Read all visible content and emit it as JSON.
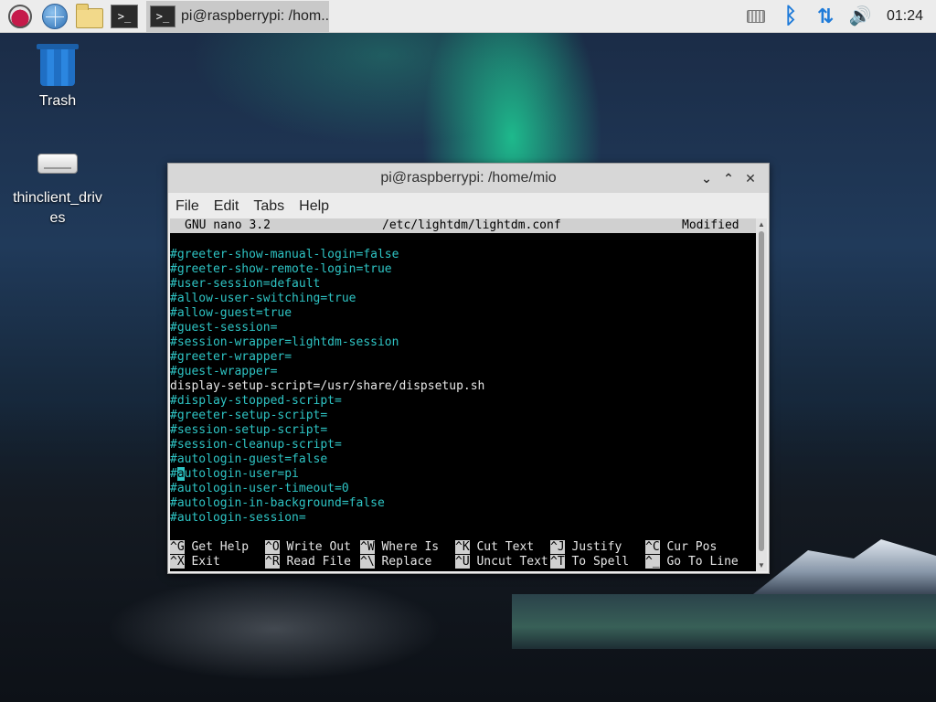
{
  "taskbar": {
    "task_title": "pi@raspberrypi: /hom...",
    "term_glyph": ">_",
    "clock": "01:24",
    "icons": [
      "raspberry-pi-menu-icon",
      "web-browser-icon",
      "file-manager-icon",
      "terminal-icon",
      "keyboard-icon",
      "bluetooth-icon",
      "network-icon",
      "volume-icon"
    ]
  },
  "desktop": {
    "trash_label": "Trash",
    "drive_label": "thinclient_driv\nes"
  },
  "window": {
    "title": "pi@raspberrypi: /home/mio",
    "controls": {
      "minimize": "⌄",
      "maximize": "⌃",
      "close": "✕"
    },
    "menu": [
      "File",
      "Edit",
      "Tabs",
      "Help"
    ]
  },
  "nano": {
    "version": "GNU nano 3.2",
    "filename": "/etc/lightdm/lightdm.conf",
    "status": "Modified",
    "lines": [
      {
        "text": "",
        "color": "cyan"
      },
      {
        "text": "#greeter-show-manual-login=false",
        "color": "cyan"
      },
      {
        "text": "#greeter-show-remote-login=true",
        "color": "cyan"
      },
      {
        "text": "#user-session=default",
        "color": "cyan"
      },
      {
        "text": "#allow-user-switching=true",
        "color": "cyan"
      },
      {
        "text": "#allow-guest=true",
        "color": "cyan"
      },
      {
        "text": "#guest-session=",
        "color": "cyan"
      },
      {
        "text": "#session-wrapper=lightdm-session",
        "color": "cyan"
      },
      {
        "text": "#greeter-wrapper=",
        "color": "cyan"
      },
      {
        "text": "#guest-wrapper=",
        "color": "cyan"
      },
      {
        "text": "display-setup-script=/usr/share/dispsetup.sh",
        "color": "white"
      },
      {
        "text": "#display-stopped-script=",
        "color": "cyan"
      },
      {
        "text": "#greeter-setup-script=",
        "color": "cyan"
      },
      {
        "text": "#session-setup-script=",
        "color": "cyan"
      },
      {
        "text": "#session-cleanup-script=",
        "color": "cyan"
      },
      {
        "text": "#autologin-guest=false",
        "color": "cyan"
      },
      {
        "text": "#autologin-user=pi",
        "color": "cyan",
        "cursor_at": 1
      },
      {
        "text": "#autologin-user-timeout=0",
        "color": "cyan"
      },
      {
        "text": "#autologin-in-background=false",
        "color": "cyan"
      },
      {
        "text": "#autologin-session=",
        "color": "cyan"
      }
    ],
    "shortcuts": [
      [
        {
          "key": "^G",
          "label": "Get Help"
        },
        {
          "key": "^O",
          "label": "Write Out"
        },
        {
          "key": "^W",
          "label": "Where Is"
        },
        {
          "key": "^K",
          "label": "Cut Text"
        },
        {
          "key": "^J",
          "label": "Justify"
        },
        {
          "key": "^C",
          "label": "Cur Pos"
        }
      ],
      [
        {
          "key": "^X",
          "label": "Exit"
        },
        {
          "key": "^R",
          "label": "Read File"
        },
        {
          "key": "^\\",
          "label": "Replace"
        },
        {
          "key": "^U",
          "label": "Uncut Text"
        },
        {
          "key": "^T",
          "label": "To Spell"
        },
        {
          "key": "^_",
          "label": "Go To Line"
        }
      ]
    ]
  }
}
